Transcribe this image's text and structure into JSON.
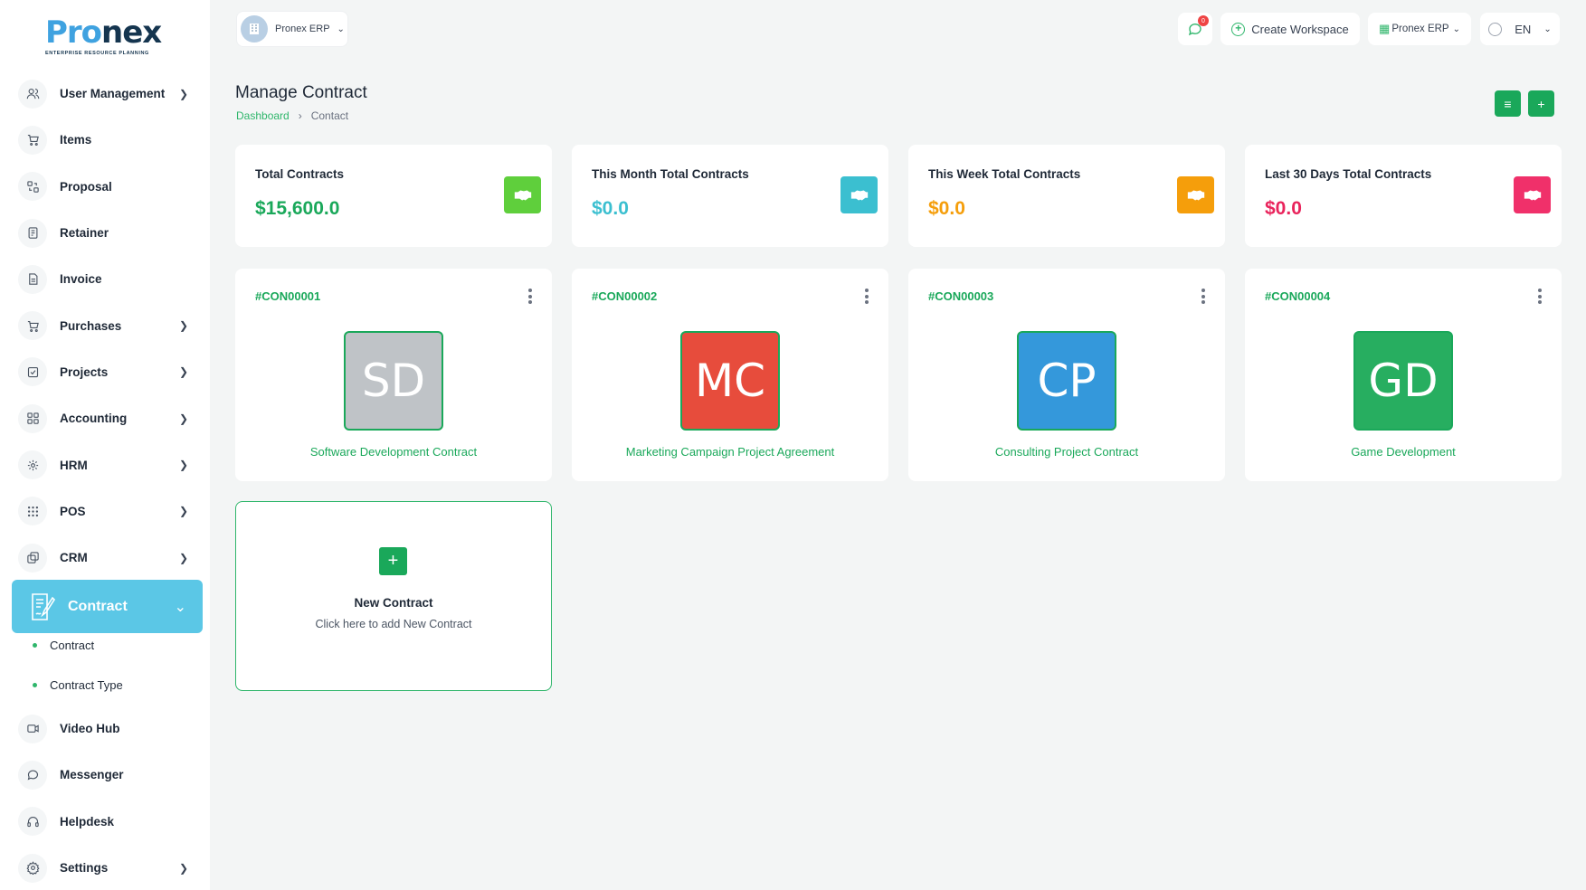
{
  "logo": {
    "word_a": "Pro",
    "word_b": "nex",
    "tagline": "ENTERPRISE RESOURCE PLANNING"
  },
  "workspace": {
    "name": "Pronex ERP"
  },
  "topbar": {
    "notification_count": "0",
    "create_workspace": "Create Workspace",
    "erp_menu": "Pronex ERP",
    "language": "EN"
  },
  "sidebar": {
    "items": [
      {
        "label": "User Management",
        "icon": "users-icon",
        "has_submenu": true
      },
      {
        "label": "Items",
        "icon": "cart-icon",
        "has_submenu": false
      },
      {
        "label": "Proposal",
        "icon": "proposal-icon",
        "has_submenu": false
      },
      {
        "label": "Retainer",
        "icon": "retainer-icon",
        "has_submenu": false
      },
      {
        "label": "Invoice",
        "icon": "invoice-icon",
        "has_submenu": false
      },
      {
        "label": "Purchases",
        "icon": "cart-icon",
        "has_submenu": true
      },
      {
        "label": "Projects",
        "icon": "checkbox-icon",
        "has_submenu": true
      },
      {
        "label": "Accounting",
        "icon": "grid-icon",
        "has_submenu": true
      },
      {
        "label": "HRM",
        "icon": "hrm-icon",
        "has_submenu": true
      },
      {
        "label": "POS",
        "icon": "dots-grid-icon",
        "has_submenu": true
      },
      {
        "label": "CRM",
        "icon": "layers-icon",
        "has_submenu": true
      }
    ],
    "active": {
      "label": "Contract",
      "icon": "contract-icon"
    },
    "sub_items": [
      {
        "label": "Contract"
      },
      {
        "label": "Contract Type"
      }
    ],
    "lower_items": [
      {
        "label": "Video Hub",
        "icon": "video-icon",
        "has_submenu": false
      },
      {
        "label": "Messenger",
        "icon": "chat-icon",
        "has_submenu": false
      },
      {
        "label": "Helpdesk",
        "icon": "headphones-icon",
        "has_submenu": false
      },
      {
        "label": "Settings",
        "icon": "gear-icon",
        "has_submenu": true
      }
    ]
  },
  "page": {
    "title": "Manage Contract",
    "breadcrumb": {
      "home": "Dashboard",
      "current": "Contact"
    }
  },
  "stats": [
    {
      "label": "Total Contracts",
      "value": "$15,600.0",
      "color": "#1aa85a",
      "icon_bg": "#5fcf3c",
      "icon": "handshake-icon"
    },
    {
      "label": "This Month Total Contracts",
      "value": "$0.0",
      "color": "#3bbfd0",
      "icon_bg": "#3bbfd0",
      "icon": "handshake-icon"
    },
    {
      "label": "This Week Total Contracts",
      "value": "$0.0",
      "color": "#f59e0b",
      "icon_bg": "#f59e0b",
      "icon": "handshake-icon"
    },
    {
      "label": "Last 30 Days Total Contracts",
      "value": "$0.0",
      "color": "#e9245c",
      "icon_bg": "#f0306a",
      "icon": "handshake-icon"
    }
  ],
  "contracts": [
    {
      "id": "#CON00001",
      "initials": "SD",
      "name": "Software Development Contract",
      "avatar_color": "#bfc3c7"
    },
    {
      "id": "#CON00002",
      "initials": "MC",
      "name": "Marketing Campaign Project Agreement",
      "avatar_color": "#e74c3c"
    },
    {
      "id": "#CON00003",
      "initials": "CP",
      "name": "Consulting Project Contract",
      "avatar_color": "#3498db"
    },
    {
      "id": "#CON00004",
      "initials": "GD",
      "name": "Game Development",
      "avatar_color": "#27ae60"
    }
  ],
  "new_contract": {
    "title": "New Contract",
    "subtitle": "Click here to add New Contract"
  }
}
